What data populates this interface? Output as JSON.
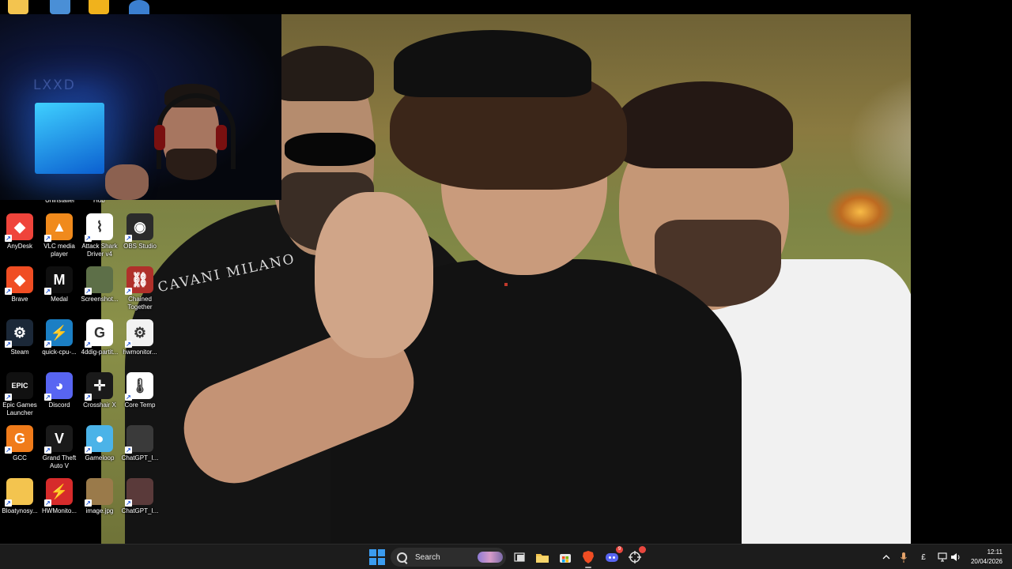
{
  "desktop": {
    "partial_labels": [
      "Uninstaller",
      "Hub"
    ],
    "icons": [
      {
        "label": "AnyDesk",
        "icon": "anydesk-icon",
        "color": "#ef443b",
        "glyph": "◆"
      },
      {
        "label": "VLC media player",
        "icon": "vlc-cone-icon",
        "color": "#f08a1c",
        "glyph": "▲"
      },
      {
        "label": "Attack Shark Driver v4",
        "icon": "attack-shark-icon",
        "color": "#ffffff",
        "glyph": "⌇"
      },
      {
        "label": "OBS Studio",
        "icon": "obs-icon",
        "color": "#2b2b2b",
        "glyph": "◉"
      },
      {
        "label": "Brave",
        "icon": "brave-lion-icon",
        "color": "#f04d23",
        "glyph": "◆"
      },
      {
        "label": "Medal",
        "icon": "medal-icon",
        "color": "#0f0f0f",
        "glyph": "M"
      },
      {
        "label": "Screenshot...",
        "icon": "screenshot-thumbnail-icon",
        "color": "#5d6f48",
        "glyph": ""
      },
      {
        "label": "Chained Together",
        "icon": "chained-together-icon",
        "color": "#b0302a",
        "glyph": "⛓"
      },
      {
        "label": "Steam",
        "icon": "steam-icon",
        "color": "#1b2838",
        "glyph": "⚙"
      },
      {
        "label": "quick-cpu-...",
        "icon": "quick-cpu-icon",
        "color": "#1b7fc4",
        "glyph": "⚡"
      },
      {
        "label": "4ddig-partit...",
        "icon": "4ddig-icon",
        "color": "#ffffff",
        "glyph": "G"
      },
      {
        "label": "hwmonitor...",
        "icon": "document-file-icon",
        "color": "#f2f2f2",
        "glyph": "⚙"
      },
      {
        "label": "Epic Games Launcher",
        "icon": "epic-games-icon",
        "color": "#111111",
        "glyph": "EPIC"
      },
      {
        "label": "Discord",
        "icon": "discord-icon",
        "color": "#5865f2",
        "glyph": "◕"
      },
      {
        "label": "Crosshair X",
        "icon": "crosshair-x-icon",
        "color": "#1a1a1a",
        "glyph": "✛"
      },
      {
        "label": "Core Temp",
        "icon": "core-temp-icon",
        "color": "#ffffff",
        "glyph": "🌡"
      },
      {
        "label": "GCC",
        "icon": "gcc-icon",
        "color": "#f07b1a",
        "glyph": "G"
      },
      {
        "label": "Grand Theft Auto V",
        "icon": "gta-v-icon",
        "color": "#1a1a1a",
        "glyph": "V"
      },
      {
        "label": "Gameloop",
        "icon": "gameloop-icon",
        "color": "#4bb3e8",
        "glyph": "●"
      },
      {
        "label": "ChatGPT_I...",
        "icon": "image-thumbnail-icon",
        "color": "#3a3a3a",
        "glyph": ""
      },
      {
        "label": "Bloatynosy...",
        "icon": "folder-icon",
        "color": "#f3c44f",
        "glyph": ""
      },
      {
        "label": "HWMonito...",
        "icon": "hwmonitor-icon",
        "color": "#d62b2b",
        "glyph": "⚡"
      },
      {
        "label": "image.jpg",
        "icon": "image-thumbnail-icon",
        "color": "#9a7a4a",
        "glyph": ""
      },
      {
        "label": "ChatGPT_I...",
        "icon": "image-thumbnail-icon",
        "color": "#5a3a3a",
        "glyph": ""
      }
    ]
  },
  "wallpaper": {
    "shirt_text": "CAVANI MILANO"
  },
  "taskbar": {
    "search_placeholder": "Search",
    "apps": [
      {
        "icon": "task-view-icon"
      },
      {
        "icon": "file-explorer-icon"
      },
      {
        "icon": "microsoft-store-icon"
      },
      {
        "icon": "brave-icon"
      },
      {
        "icon": "discord-icon",
        "badge": "9"
      },
      {
        "icon": "crosshair-icon",
        "badge": ""
      }
    ],
    "tray": {
      "currency": "£",
      "time": "12:11",
      "date": "20/04/2026"
    }
  },
  "colors": {
    "taskbar_bg": "#1c1c1c",
    "accent": "#3b9cf0"
  }
}
